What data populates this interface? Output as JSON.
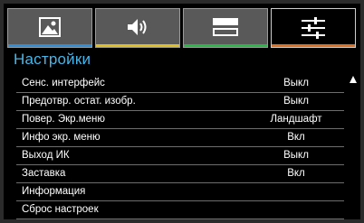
{
  "tabs": [
    {
      "id": "picture",
      "icon": "picture-icon",
      "stripe_color": "#2f8fd8",
      "active": false
    },
    {
      "id": "audio",
      "icon": "speaker-icon",
      "stripe_color": "#e0c020",
      "active": false
    },
    {
      "id": "display",
      "icon": "display-layout-icon",
      "stripe_color": "#28b848",
      "active": false
    },
    {
      "id": "settings",
      "icon": "sliders-icon",
      "stripe_color": "#e07020",
      "active": true
    }
  ],
  "menu": {
    "title": "Настройки",
    "title_color": "#48b5e8",
    "items": [
      {
        "label": "Сенс. интерфейс",
        "value": "Выкл"
      },
      {
        "label": "Предотвр. остат. изобр.",
        "value": "Выкл"
      },
      {
        "label": "Повер. Экр.меню",
        "value": "Ландшафт"
      },
      {
        "label": "Инфо экр. меню",
        "value": "Вкл"
      },
      {
        "label": "Выход ИК",
        "value": "Выкл"
      },
      {
        "label": "Заставка",
        "value": "Вкл"
      },
      {
        "label": "Информация",
        "value": ""
      },
      {
        "label": "Сброс настроек",
        "value": ""
      }
    ]
  },
  "scroll": {
    "icon": "scroll-up-arrow-icon"
  }
}
